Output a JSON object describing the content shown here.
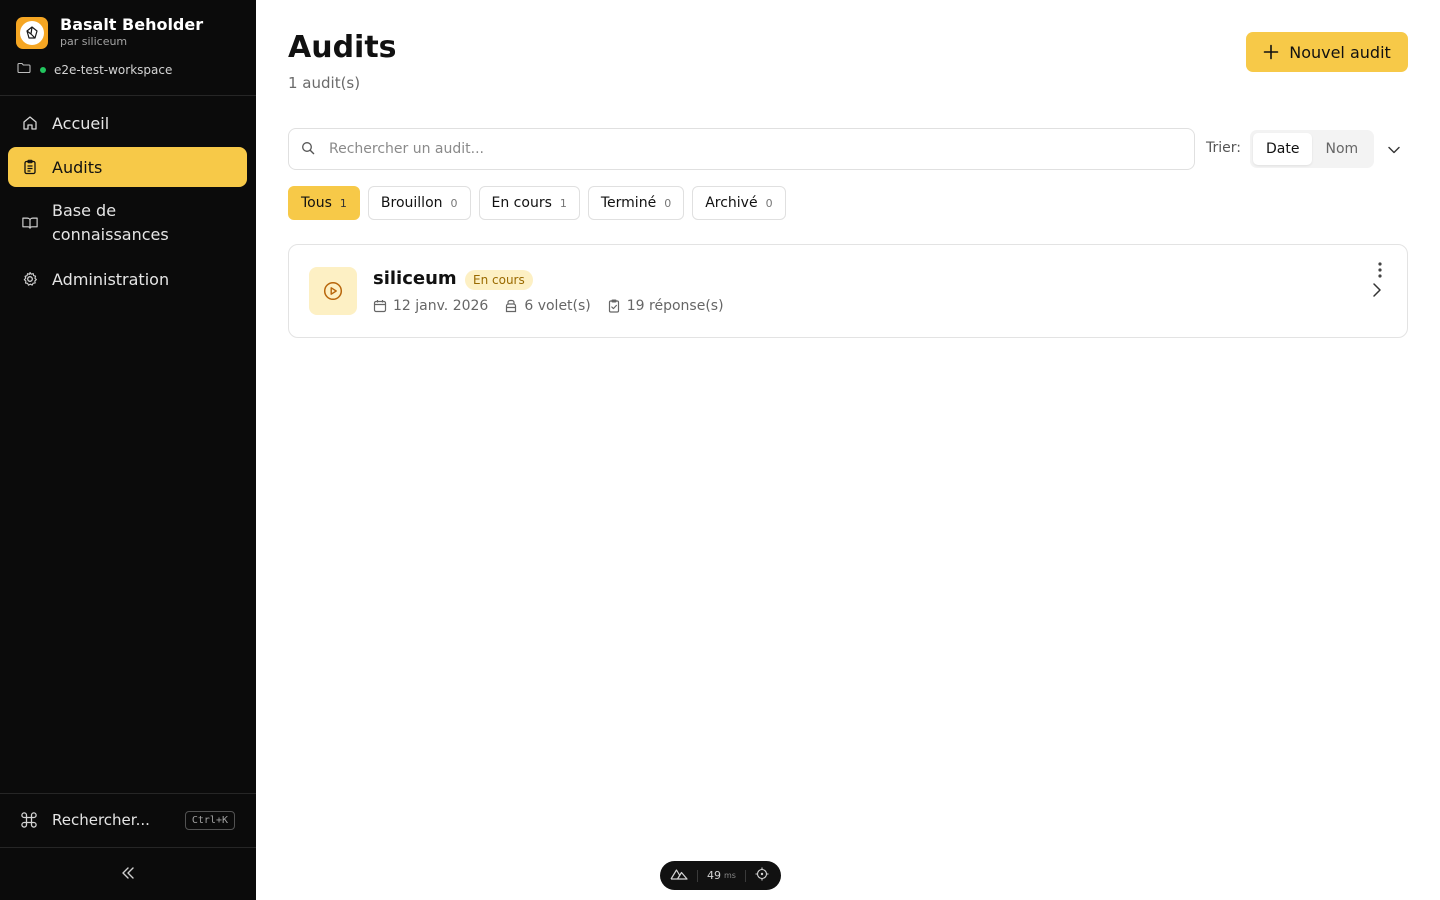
{
  "app": {
    "name": "Basalt Beholder",
    "by": "par siliceum",
    "workspace": "e2e-test-workspace"
  },
  "sidebar": {
    "items": [
      {
        "label": "Accueil"
      },
      {
        "label": "Audits"
      },
      {
        "label": "Base de connaissances"
      },
      {
        "label": "Administration"
      }
    ],
    "search_label": "Rechercher...",
    "search_shortcut": "Ctrl+K"
  },
  "page": {
    "title": "Audits",
    "count_text": "1 audit(s)",
    "new_button": "Nouvel audit"
  },
  "search": {
    "placeholder": "Rechercher un audit..."
  },
  "sort": {
    "label": "Trier:",
    "options": [
      "Date",
      "Nom"
    ],
    "selected": "Date"
  },
  "filters": [
    {
      "label": "Tous",
      "count": "1"
    },
    {
      "label": "Brouillon",
      "count": "0"
    },
    {
      "label": "En cours",
      "count": "1"
    },
    {
      "label": "Terminé",
      "count": "0"
    },
    {
      "label": "Archivé",
      "count": "0"
    }
  ],
  "audits": [
    {
      "name": "siliceum",
      "status": "En cours",
      "date": "12 janv. 2026",
      "volets": "6 volet(s)",
      "reponses": "19 réponse(s)"
    }
  ],
  "devtools": {
    "value": "49",
    "unit": "ms"
  },
  "colors": {
    "accent": "#f7c948",
    "sidebar_bg": "#0b0b0b",
    "status_bg": "#fdf0c4",
    "status_text": "#9a6a00"
  }
}
